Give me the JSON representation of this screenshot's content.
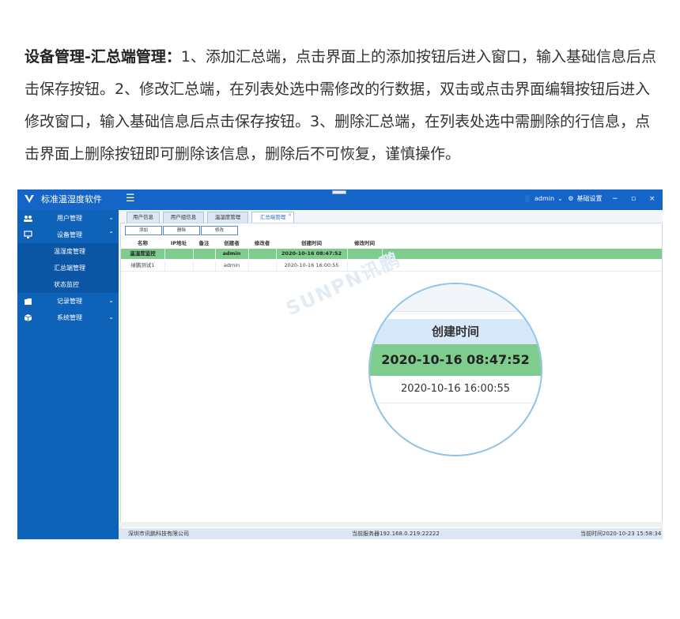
{
  "intro": {
    "heading": "设备管理-汇总端管理：",
    "body": "1、添加汇总端，点击界面上的添加按钮后进入窗口，输入基础信息后点击保存按钮。2、修改汇总端，在列表处选中需修改的行数据，双击或点击界面编辑按钮后进入修改窗口，输入基础信息后点击保存按钮。3、删除汇总端，在列表处选中需删除的行信息，点击界面上删除按钮即可删除该信息，删除后不可恢复，谨慎操作。"
  },
  "app": {
    "title": "标准温湿度软件",
    "menu_icon": "☰",
    "user": "admin",
    "user_chevron": "⌄",
    "settings": "基础设置",
    "minimize": "−",
    "restore": "▫",
    "close": "×"
  },
  "sidebar": {
    "items": [
      {
        "label": "用户管理",
        "icon": "users-icon",
        "chevron": "⌄"
      },
      {
        "label": "设备管理",
        "icon": "monitor-icon",
        "chevron": "⌃"
      },
      {
        "label": "记录管理",
        "icon": "folder-icon",
        "chevron": "⌄"
      },
      {
        "label": "系统管理",
        "icon": "cube-icon",
        "chevron": "⌄"
      }
    ],
    "sub_items": [
      {
        "label": "温湿度管理"
      },
      {
        "label": "汇总端管理"
      },
      {
        "label": "状态监控"
      }
    ]
  },
  "tabs": [
    {
      "label": "用户信息"
    },
    {
      "label": "用户组信息"
    },
    {
      "label": "温湿度管理"
    },
    {
      "label": "汇总端管理",
      "close": "×"
    }
  ],
  "toolbar": {
    "add": "添加",
    "delete": "删除",
    "edit": "修改"
  },
  "table": {
    "columns": [
      "名称",
      "IP地址",
      "备注",
      "创建者",
      "修改者",
      "创建时间",
      "修改时间"
    ],
    "rows": [
      [
        "温湿度监控",
        "",
        "",
        "admin",
        "",
        "2020-10-16 08:47:52",
        ""
      ],
      [
        "绿鹏测试1",
        "",
        "",
        "admin",
        "",
        "2020-10-16 16:00:55",
        ""
      ]
    ]
  },
  "footer": {
    "company": "深圳市讯鹏科技有限公司",
    "server": "当前服务器192.168.0.219:22222",
    "time": "当前时间2020-10-23 15:58:34"
  },
  "watermark": "SUNPN讯鹏",
  "magnifier": {
    "header": "创建时间",
    "selected": "2020-10-16 08:47:52",
    "normal": "2020-10-16 16:00:55"
  },
  "colors": {
    "brand": "#1565c8",
    "sidebar": "#0e62b8",
    "selected_row": "#7fcd8e",
    "magnifier_border": "#8ec3ea"
  }
}
